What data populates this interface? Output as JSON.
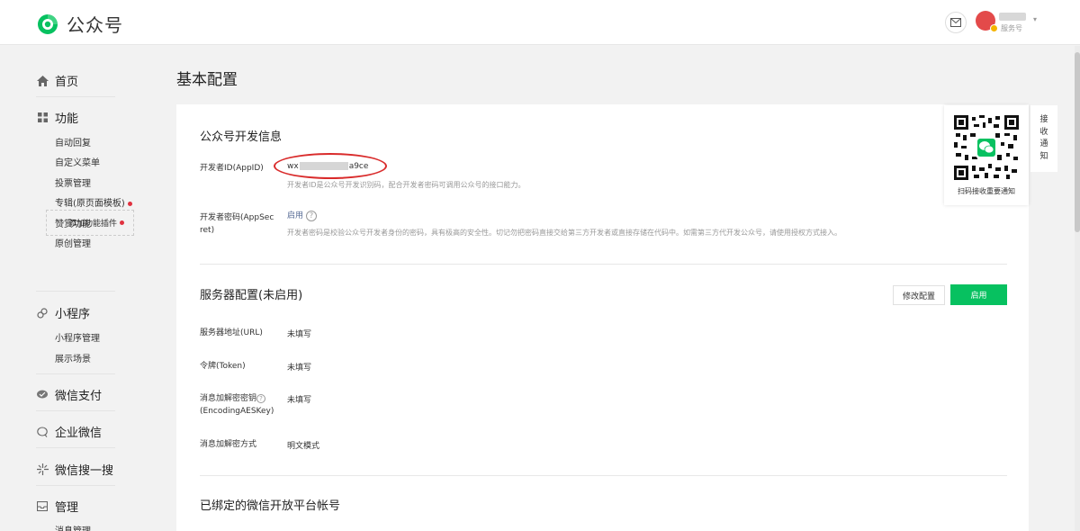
{
  "header": {
    "app_name": "公众号",
    "account_type": "服务号",
    "brand_color": "#07c160"
  },
  "sidebar": {
    "home": "首页",
    "features": {
      "label": "功能",
      "items": [
        "自动回复",
        "自定义菜单",
        "投票管理",
        "专辑(原页面模板)",
        "赞赏功能",
        "原创管理"
      ],
      "add_plugin": "添加功能插件"
    },
    "mini_program": {
      "label": "小程序",
      "items": [
        "小程序管理",
        "展示场景"
      ]
    },
    "wechat_pay": "微信支付",
    "work_wechat": "企业微信",
    "search": "微信搜一搜",
    "manage": {
      "label": "管理",
      "items": [
        "消息管理"
      ]
    }
  },
  "main": {
    "page_title": "基本配置",
    "dev_info": {
      "title": "公众号开发信息",
      "appid_label": "开发者ID(AppID)",
      "appid_prefix": "wx",
      "appid_suffix": "a9ce",
      "appid_desc": "开发者ID是公众号开发识别码，配合开发者密码可调用公众号的接口能力。",
      "secret_label_1": "开发者密码(AppSec",
      "secret_label_2": "ret)",
      "secret_value": "启用",
      "secret_desc": "开发者密码是校验公众号开发者身份的密码，具有极高的安全性。切记勿把密码直接交给第三方开发者或直接存储在代码中。如需第三方代开发公众号，请使用授权方式接入。"
    },
    "server_config": {
      "title": "服务器配置(未启用)",
      "edit_button": "修改配置",
      "enable_button": "启用",
      "url_label": "服务器地址(URL)",
      "url_value": "未填写",
      "token_label": "令牌(Token)",
      "token_value": "未填写",
      "aes_label_1": "消息加解密密钥",
      "aes_label_2": "(EncodingAESKey)",
      "aes_value": "未填写",
      "mode_label": "消息加解密方式",
      "mode_value": "明文模式"
    },
    "open_platform": {
      "title": "已绑定的微信开放平台帐号"
    }
  },
  "qr_widget": {
    "caption": "扫码接收重要通知",
    "tab_label": [
      "接",
      "收",
      "通",
      "知"
    ]
  }
}
